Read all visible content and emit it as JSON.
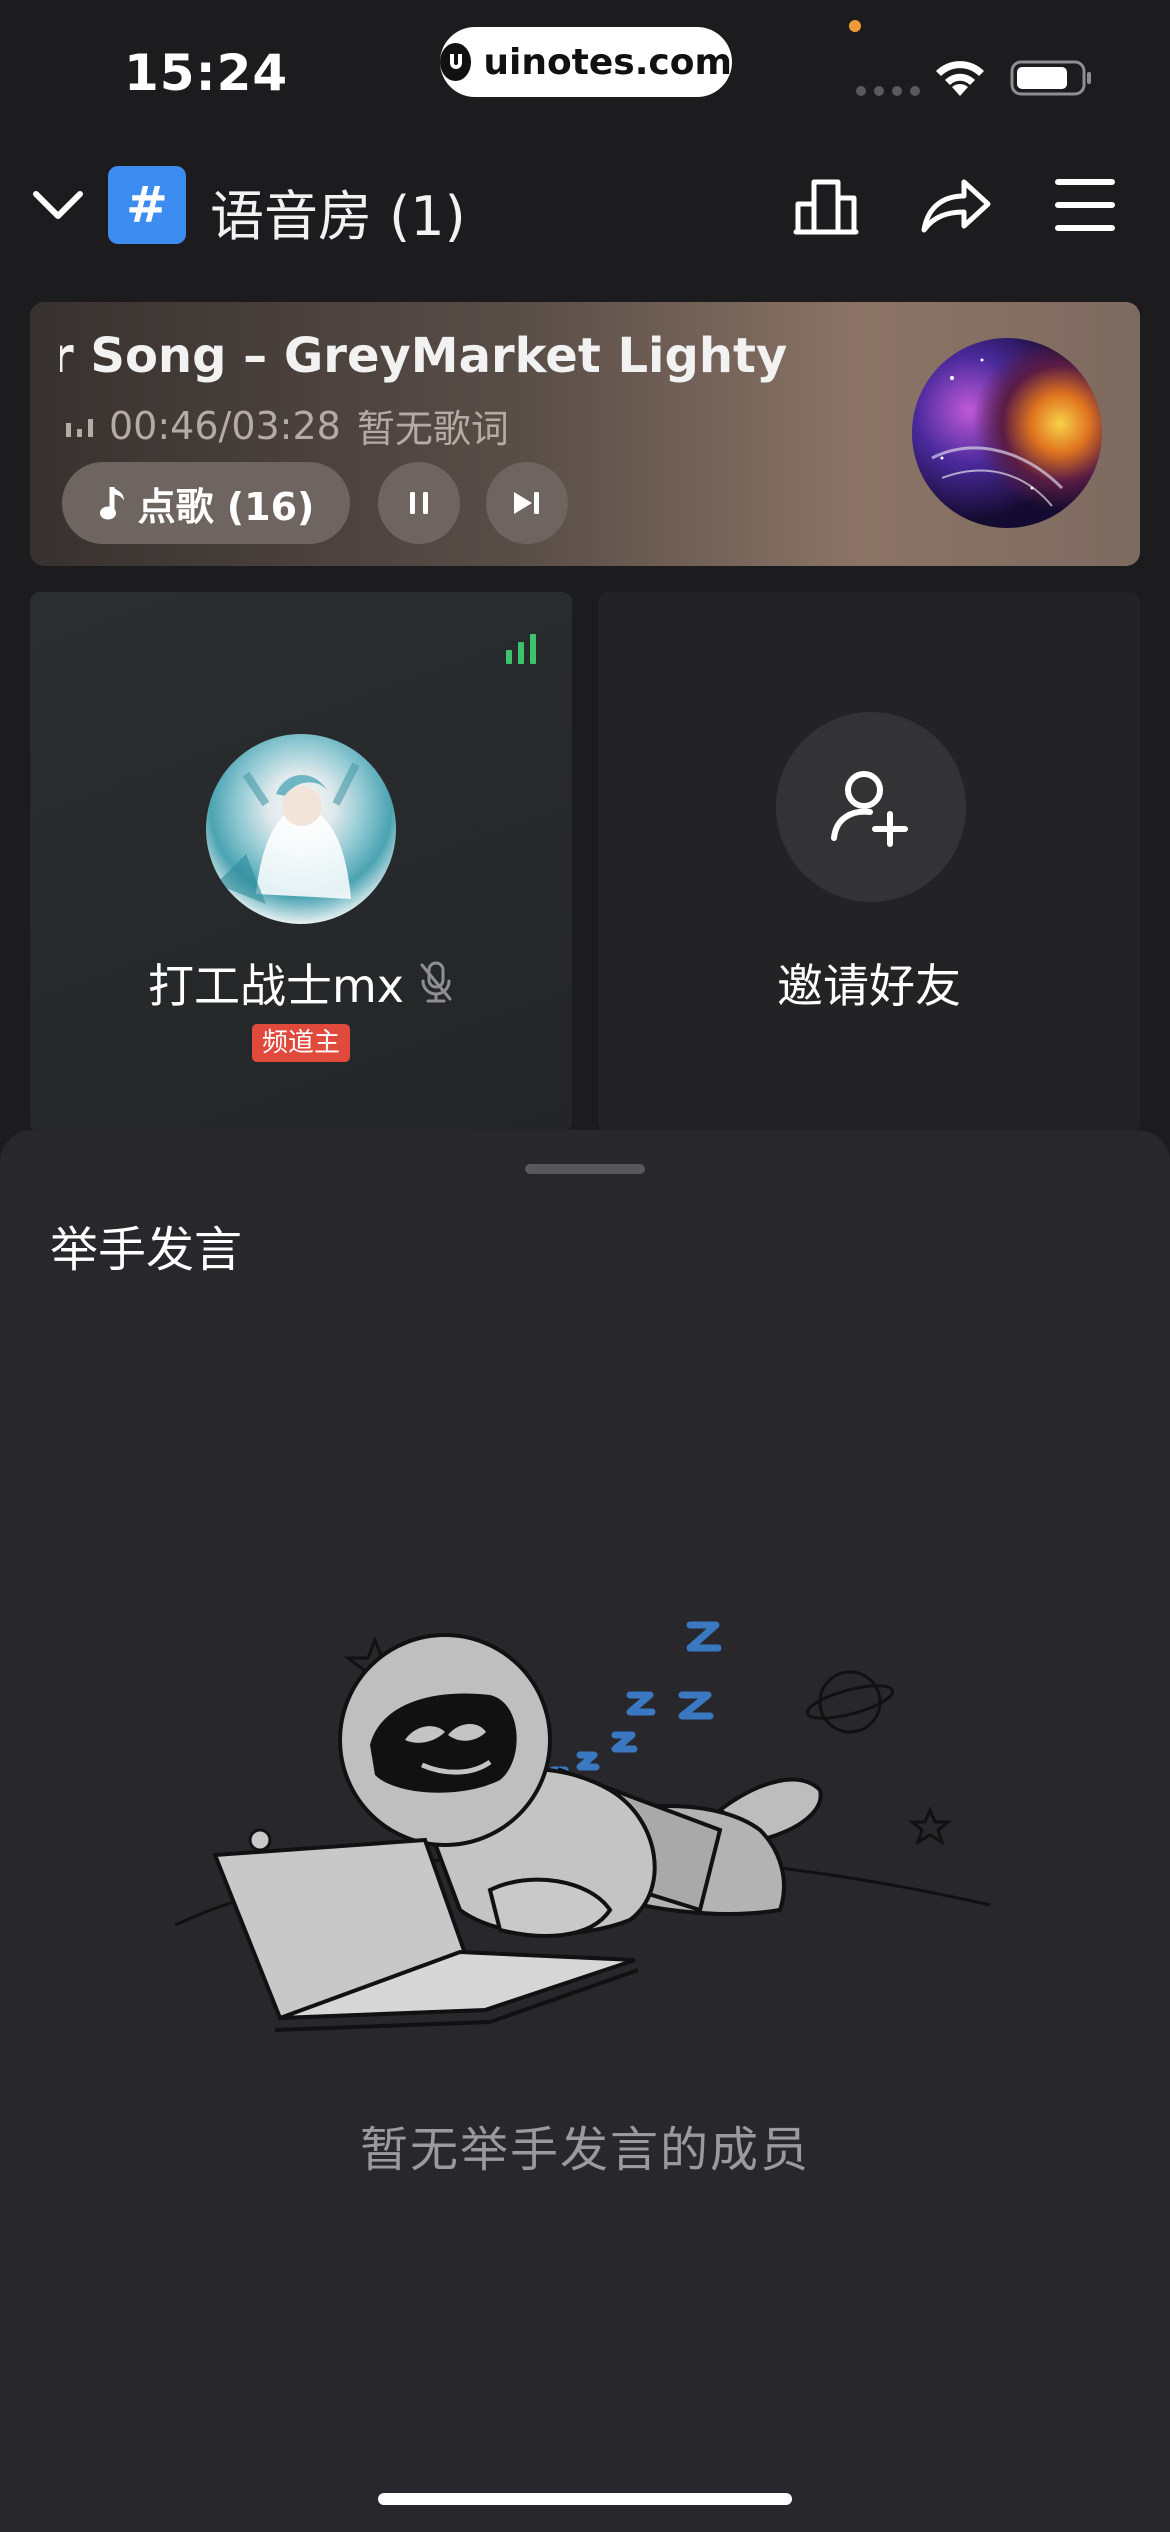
{
  "status_bar": {
    "time": "15:24",
    "url": "uinotes.com"
  },
  "header": {
    "room_title": "语音房 (1)",
    "hash_symbol": "#",
    "icons": [
      "chevron-down-icon",
      "leaderboard-icon",
      "share-icon",
      "menu-icon"
    ]
  },
  "music": {
    "song_title": "r Song – GreyMarket    Lighty",
    "progress": "00:46/03:28",
    "lyrics_status": "暂无歌词",
    "pick_song_label": "点歌 (16)"
  },
  "members": [
    {
      "name": "打工战士mx",
      "badge": "频道主",
      "muted": true
    }
  ],
  "invite": {
    "label": "邀请好友"
  },
  "raise_hand_sheet": {
    "title": "举手发言",
    "empty_text": "暂无举手发言的成员"
  },
  "colors": {
    "accent_blue": "#3d8cf0",
    "speaking_green": "#3ec36a",
    "host_badge_red": "#e04a3c"
  }
}
